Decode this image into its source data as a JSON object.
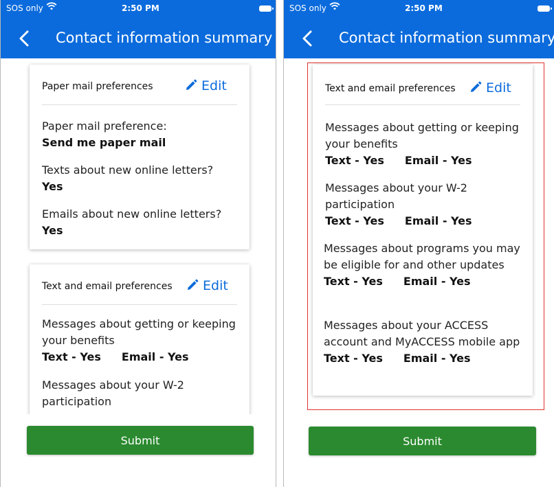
{
  "status_bar": {
    "carrier": "SOS only",
    "time": "2:50 PM"
  },
  "header": {
    "title": "Contact information summary"
  },
  "left_screen": {
    "paper_card": {
      "title": "Paper mail preferences",
      "edit_label": "Edit",
      "items": [
        {
          "question": "Paper mail preference:",
          "answer": "Send me paper mail"
        },
        {
          "question": "Texts about new online letters?",
          "answer": "Yes"
        },
        {
          "question": "Emails about new online letters?",
          "answer": "Yes"
        }
      ]
    },
    "text_email_card": {
      "title": "Text and email preferences",
      "edit_label": "Edit",
      "items": [
        {
          "question": "Messages about getting or keeping your benefits",
          "text_pref": "Text - Yes",
          "email_pref": "Email - Yes"
        },
        {
          "question": "Messages about your W-2 participation"
        }
      ]
    }
  },
  "right_screen": {
    "text_email_card": {
      "title": "Text and email preferences",
      "edit_label": "Edit",
      "items": [
        {
          "question": "Messages about getting or keeping your benefits",
          "text_pref": "Text - Yes",
          "email_pref": "Email - Yes"
        },
        {
          "question": "Messages about your W-2 participation",
          "text_pref": "Text - Yes",
          "email_pref": "Email - Yes"
        },
        {
          "question": "Messages about programs you may be eligible for and other updates",
          "text_pref": "Text - Yes",
          "email_pref": "Email - Yes"
        },
        {
          "question": "Messages about your ACCESS account and MyACCESS mobile app",
          "text_pref": "Text - Yes",
          "email_pref": "Email - Yes"
        }
      ]
    }
  },
  "submit_label": "Submit",
  "colors": {
    "primary": "#0b6bdc",
    "submit": "#2b8a2f",
    "highlight": "#e0322d"
  },
  "icons": {
    "back": "chevron-left-icon",
    "edit": "pencil-icon",
    "wifi": "wifi-icon",
    "battery": "battery-icon"
  }
}
